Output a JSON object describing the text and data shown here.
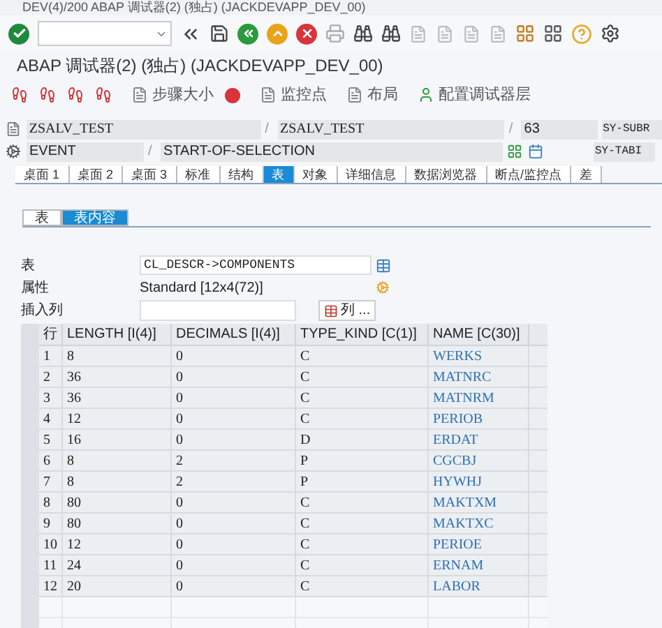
{
  "window": {
    "title": "DEV(4)/200 ABAP 调试器(2)  (独占) (JACKDEVAPP_DEV_00)"
  },
  "screen_title": "ABAP 调试器(2)  (独占) (JACKDEVAPP_DEV_00)",
  "debug_toolbar": [
    {
      "kind": "icon"
    },
    {
      "kind": "icon"
    },
    {
      "kind": "icon"
    },
    {
      "kind": "icon"
    },
    {
      "kind": "labeled",
      "label": "步骤大小"
    },
    {
      "kind": "stop"
    },
    {
      "kind": "labeled",
      "label": "监控点"
    },
    {
      "kind": "labeled",
      "label": "布局"
    },
    {
      "kind": "labeled",
      "label": "配置调试器层"
    }
  ],
  "context_rows": [
    {
      "kind": "program",
      "fields": [
        "ZSALV_TEST",
        "ZSALV_TEST",
        "63"
      ],
      "separator": "/",
      "system_field": "SY-SUBR"
    },
    {
      "kind": "event",
      "fields": [
        "EVENT",
        "START-OF-SELECTION"
      ],
      "separator": "/",
      "system_field": "SY-TABI"
    }
  ],
  "tabs": [
    {
      "label": "桌面 1",
      "selected": false
    },
    {
      "label": "桌面 2",
      "selected": false
    },
    {
      "label": "桌面 3",
      "selected": false
    },
    {
      "label": "标准",
      "selected": false
    },
    {
      "label": "结构",
      "selected": false
    },
    {
      "label": "表",
      "selected": true
    },
    {
      "label": "对象",
      "selected": false
    },
    {
      "label": "详细信息",
      "selected": false
    },
    {
      "label": "数据浏览器",
      "selected": false
    },
    {
      "label": "断点/监控点",
      "selected": false
    },
    {
      "label": "差",
      "selected": false
    }
  ],
  "subtabs": [
    {
      "label": "表",
      "selected": false
    },
    {
      "label": "表内容",
      "selected": true
    }
  ],
  "form": {
    "table_label": "表",
    "table_value": "CL_DESCR->COMPONENTS",
    "attribute_label": "属性",
    "attribute_value": "Standard [12x4(72)]",
    "insert_label": "插入列",
    "columns_button": "列 ..."
  },
  "table": {
    "columns": [
      "行",
      "LENGTH [I(4)]",
      "DECIMALS [I(4)]",
      "TYPE_KIND [C(1)]",
      "NAME [C(30)]"
    ],
    "rows": [
      [
        "1",
        "8",
        "0",
        "C",
        "WERKS"
      ],
      [
        "2",
        "36",
        "0",
        "C",
        "MATNRC"
      ],
      [
        "3",
        "36",
        "0",
        "C",
        "MATNRM"
      ],
      [
        "4",
        "12",
        "0",
        "C",
        "PERIOB"
      ],
      [
        "5",
        "16",
        "0",
        "D",
        "ERDAT"
      ],
      [
        "6",
        "8",
        "2",
        "P",
        "CGCBJ"
      ],
      [
        "7",
        "8",
        "2",
        "P",
        "HYWHJ"
      ],
      [
        "8",
        "80",
        "0",
        "C",
        "MAKTXM"
      ],
      [
        "9",
        "80",
        "0",
        "C",
        "MAKTXC"
      ],
      [
        "10",
        "12",
        "0",
        "C",
        "PERIOE"
      ],
      [
        "11",
        "24",
        "0",
        "C",
        "ERNAM"
      ],
      [
        "12",
        "20",
        "0",
        "C",
        "LABOR"
      ]
    ]
  }
}
